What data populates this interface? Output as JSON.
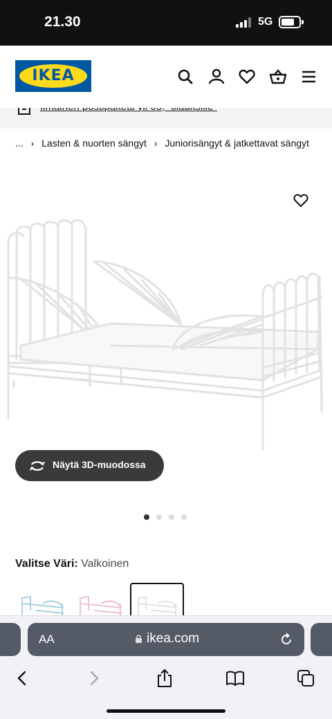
{
  "status_bar": {
    "time": "21.30",
    "network": "5G"
  },
  "header": {
    "logo_text": "IKEA",
    "brand_colors": {
      "blue": "#0058a3",
      "yellow": "#ffda1a"
    },
    "icons": [
      "search-icon",
      "account-icon",
      "heart-icon",
      "basket-icon",
      "menu-icon"
    ]
  },
  "banner": {
    "text": "Ilmainen postipaketti yli 65,- tilauksille*"
  },
  "breadcrumb": {
    "ellipsis": "...",
    "items": [
      "Lasten & nuorten sängyt",
      "Juniorisängyt & jatkettavat sängyt"
    ]
  },
  "product": {
    "view_3d_label": "Näytä 3D-muodossa",
    "image_count": 4,
    "active_image_index": 0,
    "color_label": "Valitse Väri:",
    "color_value": "Valkoinen",
    "swatches": [
      {
        "color": "#bcd6e2",
        "selected": false
      },
      {
        "color": "#f0c8d6",
        "selected": false
      },
      {
        "color": "#ffffff",
        "selected": true
      }
    ]
  },
  "browser": {
    "aa_label": "AA",
    "url": "ikea.com"
  }
}
